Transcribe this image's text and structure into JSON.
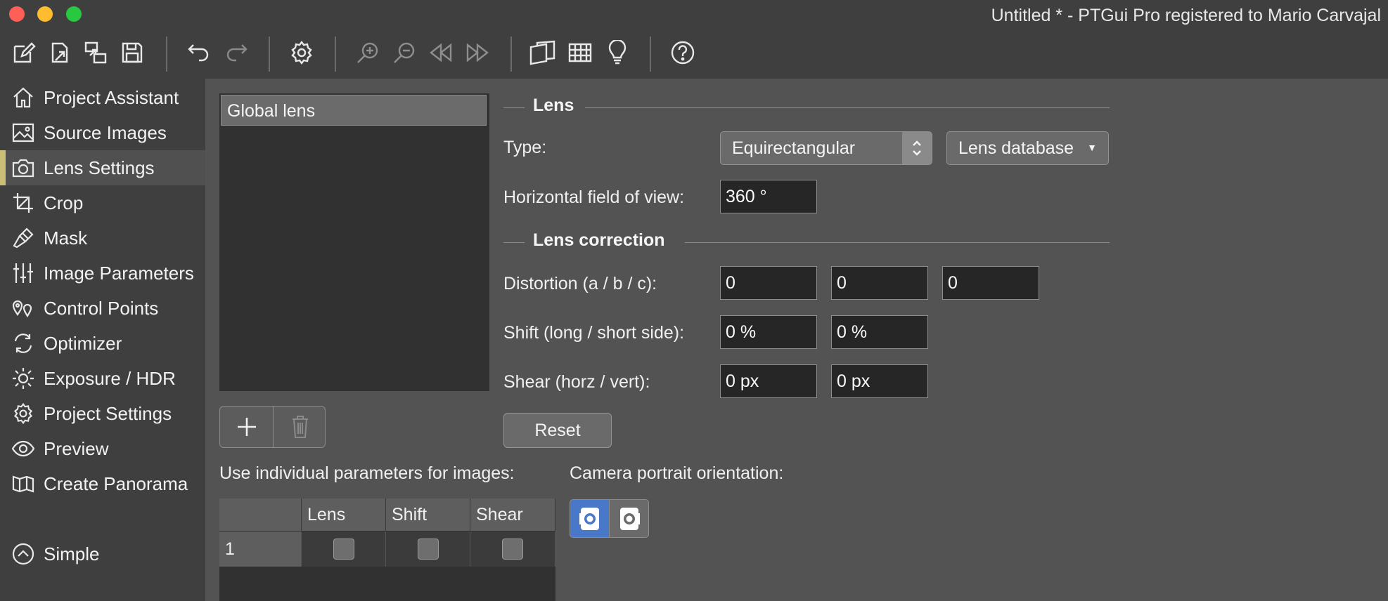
{
  "window": {
    "title": "Untitled * - PTGui Pro registered to Mario Carvajal"
  },
  "toolbar": {
    "icons": [
      "new-project-icon",
      "open-project-icon",
      "save-as-icon",
      "save-icon",
      "undo-icon",
      "redo-icon",
      "settings-gear-icon",
      "zoom-in-icon",
      "zoom-out-icon",
      "previous-icon",
      "next-icon",
      "panorama-editor-icon",
      "table-icon",
      "tips-lightbulb-icon",
      "help-icon"
    ]
  },
  "sidebar": {
    "items": [
      {
        "label": "Project Assistant",
        "icon": "home-icon"
      },
      {
        "label": "Source Images",
        "icon": "image-icon"
      },
      {
        "label": "Lens Settings",
        "icon": "camera-icon",
        "active": true
      },
      {
        "label": "Crop",
        "icon": "crop-icon"
      },
      {
        "label": "Mask",
        "icon": "brush-icon"
      },
      {
        "label": "Image Parameters",
        "icon": "sliders-icon"
      },
      {
        "label": "Control Points",
        "icon": "map-pin-icon"
      },
      {
        "label": "Optimizer",
        "icon": "refresh-icon"
      },
      {
        "label": "Exposure / HDR",
        "icon": "sun-icon"
      },
      {
        "label": "Project Settings",
        "icon": "gear-icon"
      },
      {
        "label": "Preview",
        "icon": "eye-icon"
      },
      {
        "label": "Create Panorama",
        "icon": "panorama-icon"
      }
    ],
    "simple_label": "Simple",
    "accent": "#cbbf78"
  },
  "lenslist": {
    "selected": "Global lens"
  },
  "lens": {
    "section": "Lens",
    "type_label": "Type:",
    "type_value": "Equirectangular",
    "lens_db_label": "Lens database",
    "hfov_label": "Horizontal field of view:",
    "hfov_value": "360 °"
  },
  "correction": {
    "section": "Lens correction",
    "distortion_label": "Distortion (a / b / c):",
    "distortion_values": [
      "0",
      "0",
      "0"
    ],
    "shift_label": "Shift (long / short side):",
    "shift_values": [
      "0 %",
      "0 %"
    ],
    "shear_label": "Shear (horz / vert):",
    "shear_values": [
      "0 px",
      "0 px"
    ],
    "reset_label": "Reset"
  },
  "individual": {
    "label": "Use individual parameters for images:",
    "columns": [
      "",
      "Lens",
      "Shift",
      "Shear"
    ],
    "rows": [
      {
        "index": "1",
        "lens": false,
        "shift": false,
        "shear": false
      }
    ]
  },
  "orientation": {
    "label": "Camera portrait orientation:",
    "selected_color": "#4a78c8"
  }
}
